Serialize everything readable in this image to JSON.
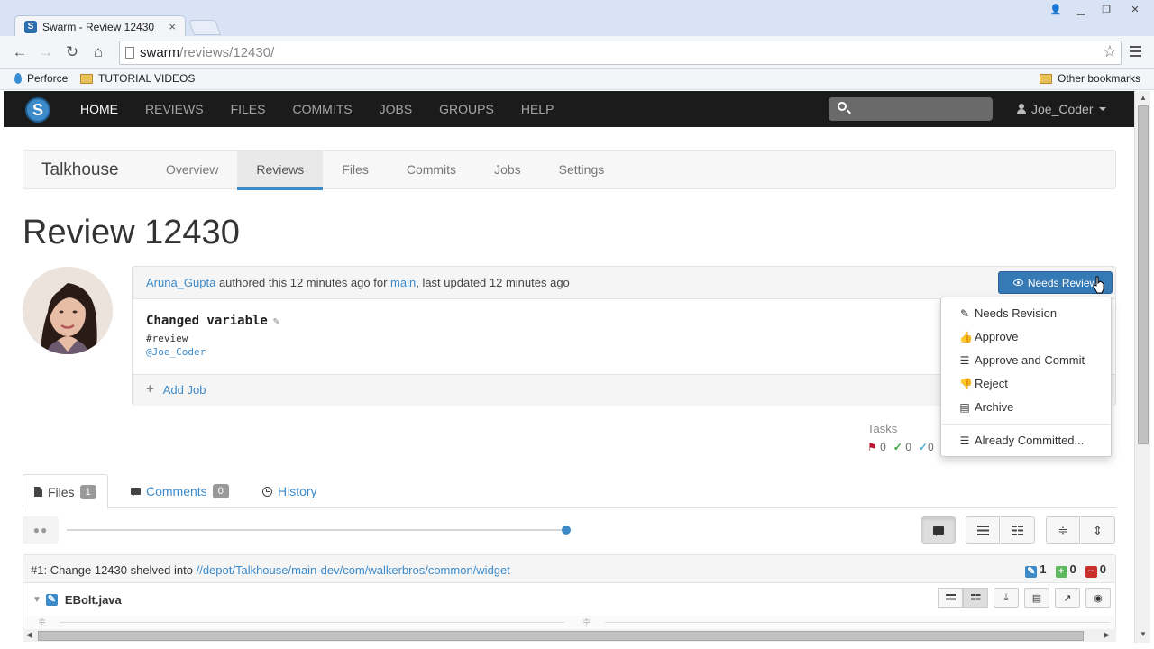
{
  "browser": {
    "tab_title": "Swarm - Review 12430",
    "favicon_letter": "S",
    "tab_close": "×",
    "url_host": "swarm",
    "url_path": "/reviews/12430/",
    "bookmarks": [
      "Perforce",
      "TUTORIAL VIDEOS"
    ],
    "other_bookmarks": "Other bookmarks"
  },
  "nav": {
    "logo": "S",
    "items": [
      {
        "label": "HOME",
        "active": true
      },
      {
        "label": "REVIEWS",
        "active": false
      },
      {
        "label": "FILES",
        "active": false
      },
      {
        "label": "COMMITS",
        "active": false
      },
      {
        "label": "JOBS",
        "active": false
      },
      {
        "label": "GROUPS",
        "active": false
      },
      {
        "label": "HELP",
        "active": false
      }
    ],
    "search_placeholder": "",
    "user": "Joe_Coder"
  },
  "project": {
    "name": "Talkhouse",
    "tabs": [
      "Overview",
      "Reviews",
      "Files",
      "Commits",
      "Jobs",
      "Settings"
    ],
    "active_tab": "Reviews"
  },
  "review": {
    "title": "Review 12430",
    "author": "Aruna_Gupta",
    "authored_text": " authored this 12 minutes ago for ",
    "branch": "main",
    "updated_text": ", last updated 12 minutes ago",
    "status_button": "Needs Review",
    "description_title": "Changed variable",
    "description_tag": "#review",
    "description_mention": "@Joe_Coder",
    "add_job": "Add Job",
    "tasks_label": "Tasks",
    "tasks": {
      "open": "0",
      "addressed": "0",
      "verified": "0"
    }
  },
  "status_menu": {
    "items": [
      {
        "label": "Needs Revision",
        "icon": "pencil-icon"
      },
      {
        "label": "Approve",
        "icon": "thumbs-up-icon"
      },
      {
        "label": "Approve and Commit",
        "icon": "stack-icon"
      },
      {
        "label": "Reject",
        "icon": "thumbs-down-icon"
      },
      {
        "label": "Archive",
        "icon": "archive-icon"
      }
    ],
    "extra": {
      "label": "Already Committed...",
      "icon": "stack-icon"
    }
  },
  "lower_tabs": {
    "files": {
      "label": "Files",
      "count": "1"
    },
    "comments": {
      "label": "Comments",
      "count": "0"
    },
    "history": {
      "label": "History"
    }
  },
  "version_slider": {
    "position_fraction": 1.0
  },
  "change": {
    "number": "#1:",
    "text": " Change 12430 shelved into ",
    "path": "//depot/Talkhouse/main-dev/com/walkerbros/common/widget",
    "edited": "1",
    "added": "0",
    "deleted": "0"
  },
  "file": {
    "name": "EBolt.java"
  },
  "colors": {
    "accent": "#3d8ac9",
    "nav_bg": "#1b1b1b",
    "button_blue": "#3579b5"
  }
}
